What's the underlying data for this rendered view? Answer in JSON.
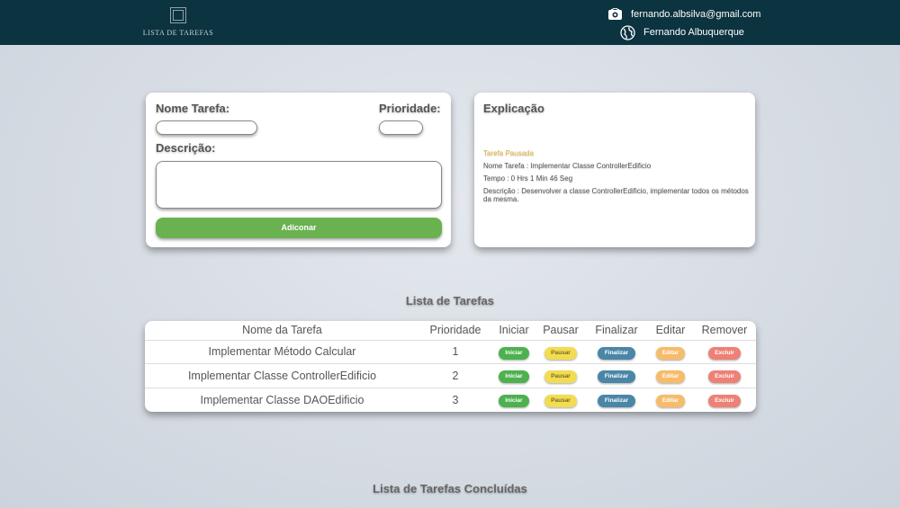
{
  "header": {
    "logo_text": "LISTA DE TAREFAS",
    "email": "fernando.albsilva@gmail.com",
    "user_name": "Fernando Albuquerque"
  },
  "form": {
    "task_name_label": "Nome Tarefa:",
    "priority_label": "Prioridade:",
    "description_label": "Descrição:",
    "task_name_value": "",
    "priority_value": "",
    "description_value": "",
    "add_button": "Adiconar"
  },
  "explanation": {
    "title": "Explicação",
    "status": "Tarefa Pausada",
    "name_line": "Nome Tarefa : Implementar Classe ControllerEdificio",
    "time_line": "Tempo : 0 Hrs 1 Min 46 Seg",
    "description_line": "Descrição : Desenvolver a classe ControllerEdificio, implementar todos os métodos da mesma."
  },
  "tasks_section_title": "Lista de Tarefas",
  "completed_section_title": "Lista de Tarefas Concluídas",
  "table": {
    "headers": [
      "Nome da Tarefa",
      "Prioridade",
      "Iniciar",
      "Pausar",
      "Finalizar",
      "Editar",
      "Remover"
    ],
    "rows": [
      {
        "name": "Implementar Método Calcular",
        "priority": "1",
        "start": "Iniciar",
        "pause": "Pausar",
        "finish": "Finalizar",
        "edit": "Editar",
        "remove": "Excluir"
      },
      {
        "name": "Implementar Classe ControllerEdificio",
        "priority": "2",
        "start": "Iniciar",
        "pause": "Pausar",
        "finish": "Finalizar",
        "edit": "Editar",
        "remove": "Excluir"
      },
      {
        "name": "Implementar Classe DAOEdificio",
        "priority": "3",
        "start": "Iniciar",
        "pause": "Pausar",
        "finish": "Finalizar",
        "edit": "Editar",
        "remove": "Excluir"
      }
    ]
  },
  "colors": {
    "header_bg": "#0c3340",
    "add_button": "#6ab150",
    "start": "#4db14f",
    "pause": "#f2dc52",
    "finish": "#4a86a7",
    "edit": "#f6bc6a",
    "remove": "#ee8076",
    "paused_status": "#e0b040"
  },
  "icons": {
    "email": "envelope-icon",
    "user": "globe-user-icon",
    "logo": "stacked-squares-icon"
  }
}
